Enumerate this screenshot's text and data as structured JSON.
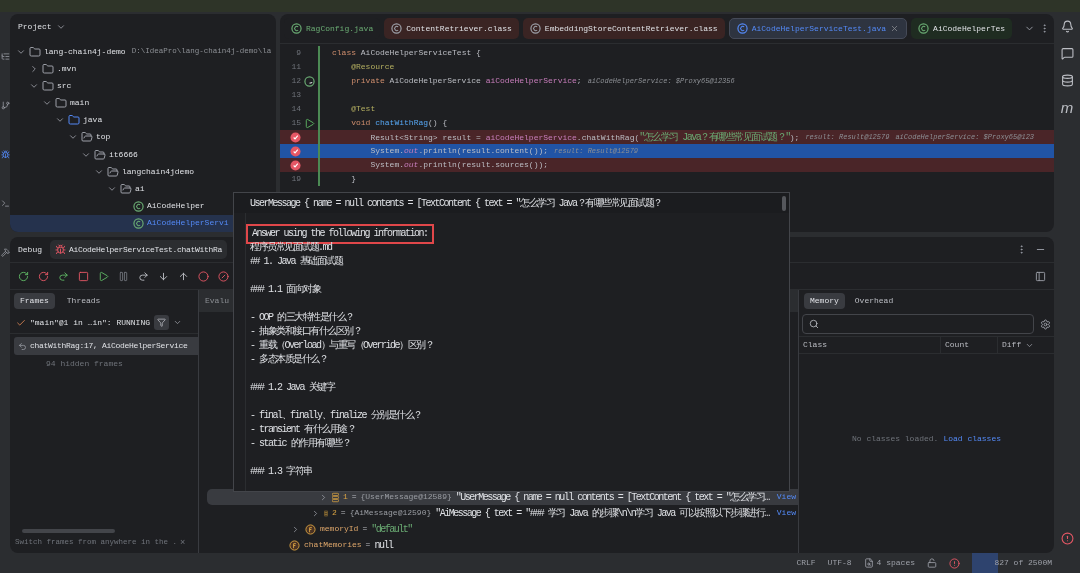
{
  "project": {
    "title": "Project",
    "tree": [
      {
        "label": "lang-chain4j-demo",
        "path": "D:\\IdeaPro\\lang-chain4j-demo\\la",
        "kind": "module",
        "expanded": true,
        "selected": false,
        "children": [
          {
            "label": ".mvn",
            "kind": "folder",
            "expanded": false,
            "selected": false
          },
          {
            "label": "src",
            "kind": "folder",
            "expanded": true,
            "selected": false,
            "children": [
              {
                "label": "main",
                "kind": "folder",
                "expanded": true,
                "selected": false,
                "children": [
                  {
                    "label": "java",
                    "kind": "source",
                    "expanded": true,
                    "selected": false,
                    "children": [
                      {
                        "label": "top",
                        "kind": "package",
                        "expanded": true,
                        "selected": false,
                        "children": [
                          {
                            "label": "it6666",
                            "kind": "package",
                            "expanded": true,
                            "selected": false,
                            "children": [
                              {
                                "label": "langchain4jdemo",
                                "kind": "package",
                                "expanded": true,
                                "selected": false,
                                "children": [
                                  {
                                    "label": "ai",
                                    "kind": "package",
                                    "expanded": true,
                                    "selected": false,
                                    "children": [
                                      {
                                        "label": "AiCodeHelper",
                                        "kind": "class",
                                        "selected": false
                                      },
                                      {
                                        "label": "AiCodeHelperServi",
                                        "kind": "class",
                                        "selected": true
                                      }
                                    ]
                                  }
                                ]
                              }
                            ]
                          }
                        ]
                      }
                    ]
                  }
                ]
              }
            ]
          }
        ]
      }
    ]
  },
  "editor": {
    "tabs": [
      {
        "label": "RagConfig.java",
        "kind": "source",
        "selected": false
      },
      {
        "label": "ContentRetriever.class",
        "kind": "library",
        "selected": false
      },
      {
        "label": "EmbeddingStoreContentRetriever.class",
        "kind": "library",
        "selected": false
      },
      {
        "label": "AiCodeHelperServiceTest.java",
        "kind": "test",
        "selected": true
      },
      {
        "label": "AiCodeHelperTes",
        "kind": "test",
        "selected": false
      }
    ],
    "lines": [
      {
        "number": "9",
        "breakpoint": false,
        "current": false,
        "segments": [
          {
            "text": "class ",
            "kind": "keyword"
          },
          {
            "text": "AiCodeHelperServiceTest {",
            "kind": "plain"
          }
        ]
      },
      {
        "number": "11",
        "breakpoint": false,
        "current": false,
        "segments": [
          {
            "text": "    @Resource",
            "kind": "annotation"
          }
        ]
      },
      {
        "number": "12",
        "gutter": {
          "kind": "bean"
        },
        "breakpoint": false,
        "current": false,
        "segments": [
          {
            "text": "    private ",
            "kind": "keyword"
          },
          {
            "text": "AiCodeHelperService ",
            "kind": "plain"
          },
          {
            "text": "aiCodeHelperService",
            "kind": "field"
          },
          {
            "text": ";",
            "kind": "plain"
          }
        ],
        "hints": [
          "aiCodeHelperService: $Proxy65@12356"
        ]
      },
      {
        "number": "13",
        "breakpoint": false,
        "current": false
      },
      {
        "number": "14",
        "breakpoint": false,
        "current": false,
        "segments": [
          {
            "text": "    @Test",
            "kind": "annotation"
          }
        ]
      },
      {
        "number": "15",
        "gutter": {
          "kind": "run"
        },
        "breakpoint": false,
        "current": false,
        "segments": [
          {
            "text": "    void ",
            "kind": "keyword"
          },
          {
            "text": "chatWithRag",
            "kind": "method"
          },
          {
            "text": "() {",
            "kind": "plain"
          }
        ]
      },
      {
        "breakpoint": true,
        "current": false,
        "segments": [
          {
            "text": "        Result<String> result = ",
            "kind": "plain"
          },
          {
            "text": "aiCodeHelperService",
            "kind": "field"
          },
          {
            "text": ".chatWithRag(",
            "kind": "plain"
          },
          {
            "text": "\"怎么学习 Java？有哪些常见面试题？\"",
            "kind": "string"
          },
          {
            "text": ");",
            "kind": "plain"
          }
        ],
        "hints": [
          "result: Result@12579",
          "aiCodeHelperService: $Proxy65@123"
        ]
      },
      {
        "breakpoint": true,
        "current": true,
        "segments": [
          {
            "text": "        System.",
            "kind": "plain"
          },
          {
            "text": "out",
            "kind": "static"
          },
          {
            "text": ".println(result.content());",
            "kind": "plain"
          }
        ],
        "hints": [
          "result: Result@12579"
        ]
      },
      {
        "breakpoint": true,
        "current": false,
        "segments": [
          {
            "text": "        System.",
            "kind": "plain"
          },
          {
            "text": "out",
            "kind": "static"
          },
          {
            "text": ".println(result.sources());",
            "kind": "plain"
          }
        ]
      },
      {
        "number": "19",
        "breakpoint": false,
        "current": false,
        "segments": [
          {
            "text": "    }",
            "kind": "plain"
          }
        ]
      }
    ]
  },
  "right_toolbar": {
    "maven_label": "m"
  },
  "debug": {
    "title": "Debug",
    "session": "AiCodeHelperServiceTest.chatWithRa",
    "frame_tabs": [
      {
        "label": "Frames",
        "selected": true
      },
      {
        "label": "Threads",
        "selected": false
      }
    ],
    "thread": "\"main\"@1 in …in\": RUNNING",
    "frames": [
      {
        "label": "chatWithRag:17, AiCodeHelperService",
        "selected": true
      }
    ],
    "hidden_frames": "94 hidden frames",
    "hint": "Switch frames from anywhere in the .",
    "hint_close": "×",
    "evaluate_placeholder": "Evalu",
    "variables": [
      {
        "kind": "element",
        "name": "1",
        "operator": "=",
        "type": "{UserMessage@12589}",
        "value": "\"UserMessage { name = null contents = [TextContent { text = \"怎么学习…",
        "link": "View",
        "expanded": false,
        "selected": true
      },
      {
        "kind": "element",
        "name": "2",
        "operator": "=",
        "type": "{AiMessage@12590}",
        "value": "\"AiMessage { text = \"### 学习 Java 的步骤\\n\\n学习 Java 可以按照以下步骤进行…",
        "link": "View",
        "expanded": false,
        "selected": false
      },
      {
        "kind": "field",
        "name": "memoryId",
        "operator": "=",
        "value": "\"default\"",
        "expanded": false,
        "selected": false
      },
      {
        "kind": "root_field",
        "name": "chatMemories",
        "operator": "=",
        "value": "null",
        "selected": false
      }
    ],
    "memory": {
      "tabs": [
        {
          "label": "Memory",
          "selected": true
        },
        {
          "label": "Overhead",
          "selected": false
        }
      ],
      "columns": [
        "Class",
        "Count",
        "Diff"
      ],
      "empty_text": "No classes loaded.",
      "load_link": "Load classes"
    }
  },
  "popup": {
    "header": "UserMessage { name = null contents = [TextContent { text = \"怎么学习 Java？有哪些常见面试题？",
    "blocks": [
      {
        "lines": [
          {
            "text": "Answer using the following information:",
            "highlighted": true
          },
          {
            "text": "程序员常见面试题.md",
            "highlighted": false
          },
          {
            "text": "## 1. Java 基础面试题",
            "highlighted": false
          }
        ]
      },
      {
        "lines": [
          {
            "text": "### 1.1 面向对象",
            "highlighted": false
          }
        ]
      },
      {
        "lines": [
          {
            "text": "- OOP 的三大特性是什么？",
            "highlighted": false
          },
          {
            "text": "- 抽象类和接口有什么区别？",
            "highlighted": false
          },
          {
            "text": "- 重载（Overload）与重写（Override）区别？",
            "highlighted": false
          },
          {
            "text": "- 多态本质是什么？",
            "highlighted": false
          }
        ]
      },
      {
        "lines": [
          {
            "text": "### 1.2 Java 关键字",
            "highlighted": false
          }
        ]
      },
      {
        "lines": [
          {
            "text": "- final、finally、finalize 分别是什么？",
            "highlighted": false
          },
          {
            "text": "- transient 有什么用途？",
            "highlighted": false
          },
          {
            "text": "- static 的作用有哪些？",
            "highlighted": false
          }
        ]
      },
      {
        "lines": [
          {
            "text": "### 1.3 字符串",
            "highlighted": false
          }
        ]
      }
    ]
  },
  "status_bar": {
    "line_separator": "CRLF",
    "encoding": "UTF-8",
    "indent": "4 spaces",
    "memory": {
      "text": "827 of 2500M",
      "level": 0.33
    }
  }
}
